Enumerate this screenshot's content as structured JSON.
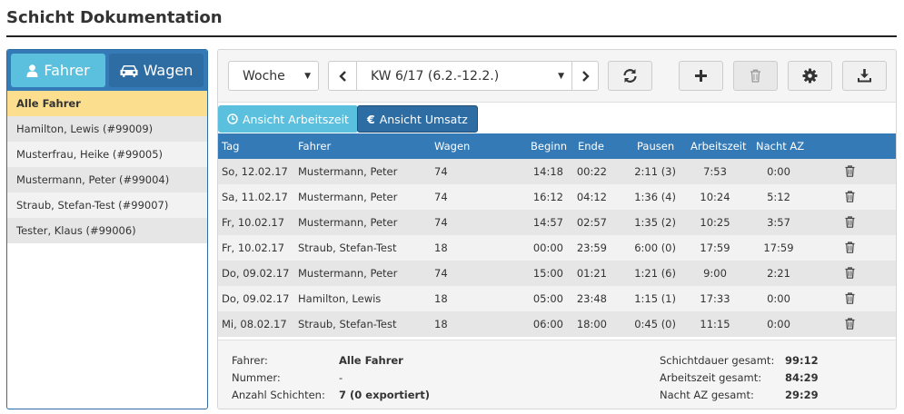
{
  "page": {
    "title": "Schicht Dokumentation"
  },
  "left": {
    "tabs": {
      "fahrer": "Fahrer",
      "wagen": "Wagen"
    },
    "items": [
      "Alle Fahrer",
      "Hamilton, Lewis (#99009)",
      "Musterfrau, Heike (#99005)",
      "Mustermann, Peter (#99004)",
      "Straub, Stefan-Test (#99007)",
      "Tester, Klaus (#99006)"
    ]
  },
  "toolbar": {
    "period": "Woche",
    "week": "KW 6/17 (6.2.-12.2.)",
    "prev_icon": "chevron-left-icon",
    "next_icon": "chevron-right-icon",
    "refresh_icon": "refresh-icon",
    "add_icon": "plus-icon",
    "delete_icon": "trash-icon",
    "settings_icon": "gear-icon",
    "download_icon": "download-icon"
  },
  "views": {
    "arbeitszeit": "Ansicht Arbeitszeit",
    "umsatz": "Ansicht Umsatz"
  },
  "columns": {
    "tag": "Tag",
    "fahrer": "Fahrer",
    "wagen": "Wagen",
    "beginn": "Beginn",
    "ende": "Ende",
    "pausen": "Pausen",
    "arbeitszeit": "Arbeitszeit",
    "nacht": "Nacht AZ"
  },
  "rows": [
    {
      "tag": "So, 12.02.17",
      "fahrer": "Mustermann, Peter",
      "wagen": "74",
      "beginn": "14:18",
      "ende": "00:22",
      "pausen": "2:11 (3)",
      "arbeitszeit": "7:53",
      "nacht": "0:00"
    },
    {
      "tag": "Sa, 11.02.17",
      "fahrer": "Mustermann, Peter",
      "wagen": "74",
      "beginn": "16:12",
      "ende": "04:12",
      "pausen": "1:36 (4)",
      "arbeitszeit": "10:24",
      "nacht": "5:12"
    },
    {
      "tag": "Fr, 10.02.17",
      "fahrer": "Mustermann, Peter",
      "wagen": "74",
      "beginn": "14:57",
      "ende": "02:57",
      "pausen": "1:35 (2)",
      "arbeitszeit": "10:25",
      "nacht": "3:57"
    },
    {
      "tag": "Fr, 10.02.17",
      "fahrer": "Straub, Stefan-Test",
      "wagen": "18",
      "beginn": "00:00",
      "ende": "23:59",
      "pausen": "6:00 (0)",
      "arbeitszeit": "17:59",
      "nacht": "17:59"
    },
    {
      "tag": "Do, 09.02.17",
      "fahrer": "Mustermann, Peter",
      "wagen": "74",
      "beginn": "15:00",
      "ende": "01:21",
      "pausen": "1:21 (6)",
      "arbeitszeit": "9:00",
      "nacht": "2:21"
    },
    {
      "tag": "Do, 09.02.17",
      "fahrer": "Hamilton, Lewis",
      "wagen": "18",
      "beginn": "05:00",
      "ende": "23:48",
      "pausen": "1:15 (1)",
      "arbeitszeit": "17:33",
      "nacht": "0:00"
    },
    {
      "tag": "Mi, 08.02.17",
      "fahrer": "Straub, Stefan-Test",
      "wagen": "18",
      "beginn": "06:00",
      "ende": "18:00",
      "pausen": "0:45 (0)",
      "arbeitszeit": "11:15",
      "nacht": "0:00"
    }
  ],
  "footer": {
    "fahrer_label": "Fahrer:",
    "fahrer_value": "Alle Fahrer",
    "nummer_label": "Nummer:",
    "nummer_value": "-",
    "anzahl_label": "Anzahl Schichten:",
    "anzahl_value": "7 (0 exportiert)",
    "schichtdauer_label": "Schichtdauer gesamt:",
    "schichtdauer_value": "99:12",
    "arbeitszeit_label": "Arbeitszeit gesamt:",
    "arbeitszeit_value": "84:29",
    "nacht_label": "Nacht AZ gesamt:",
    "nacht_value": "29:29"
  },
  "colors": {
    "primary": "#337ab7",
    "active": "#5bc0de",
    "selected": "#fbdf8f"
  }
}
